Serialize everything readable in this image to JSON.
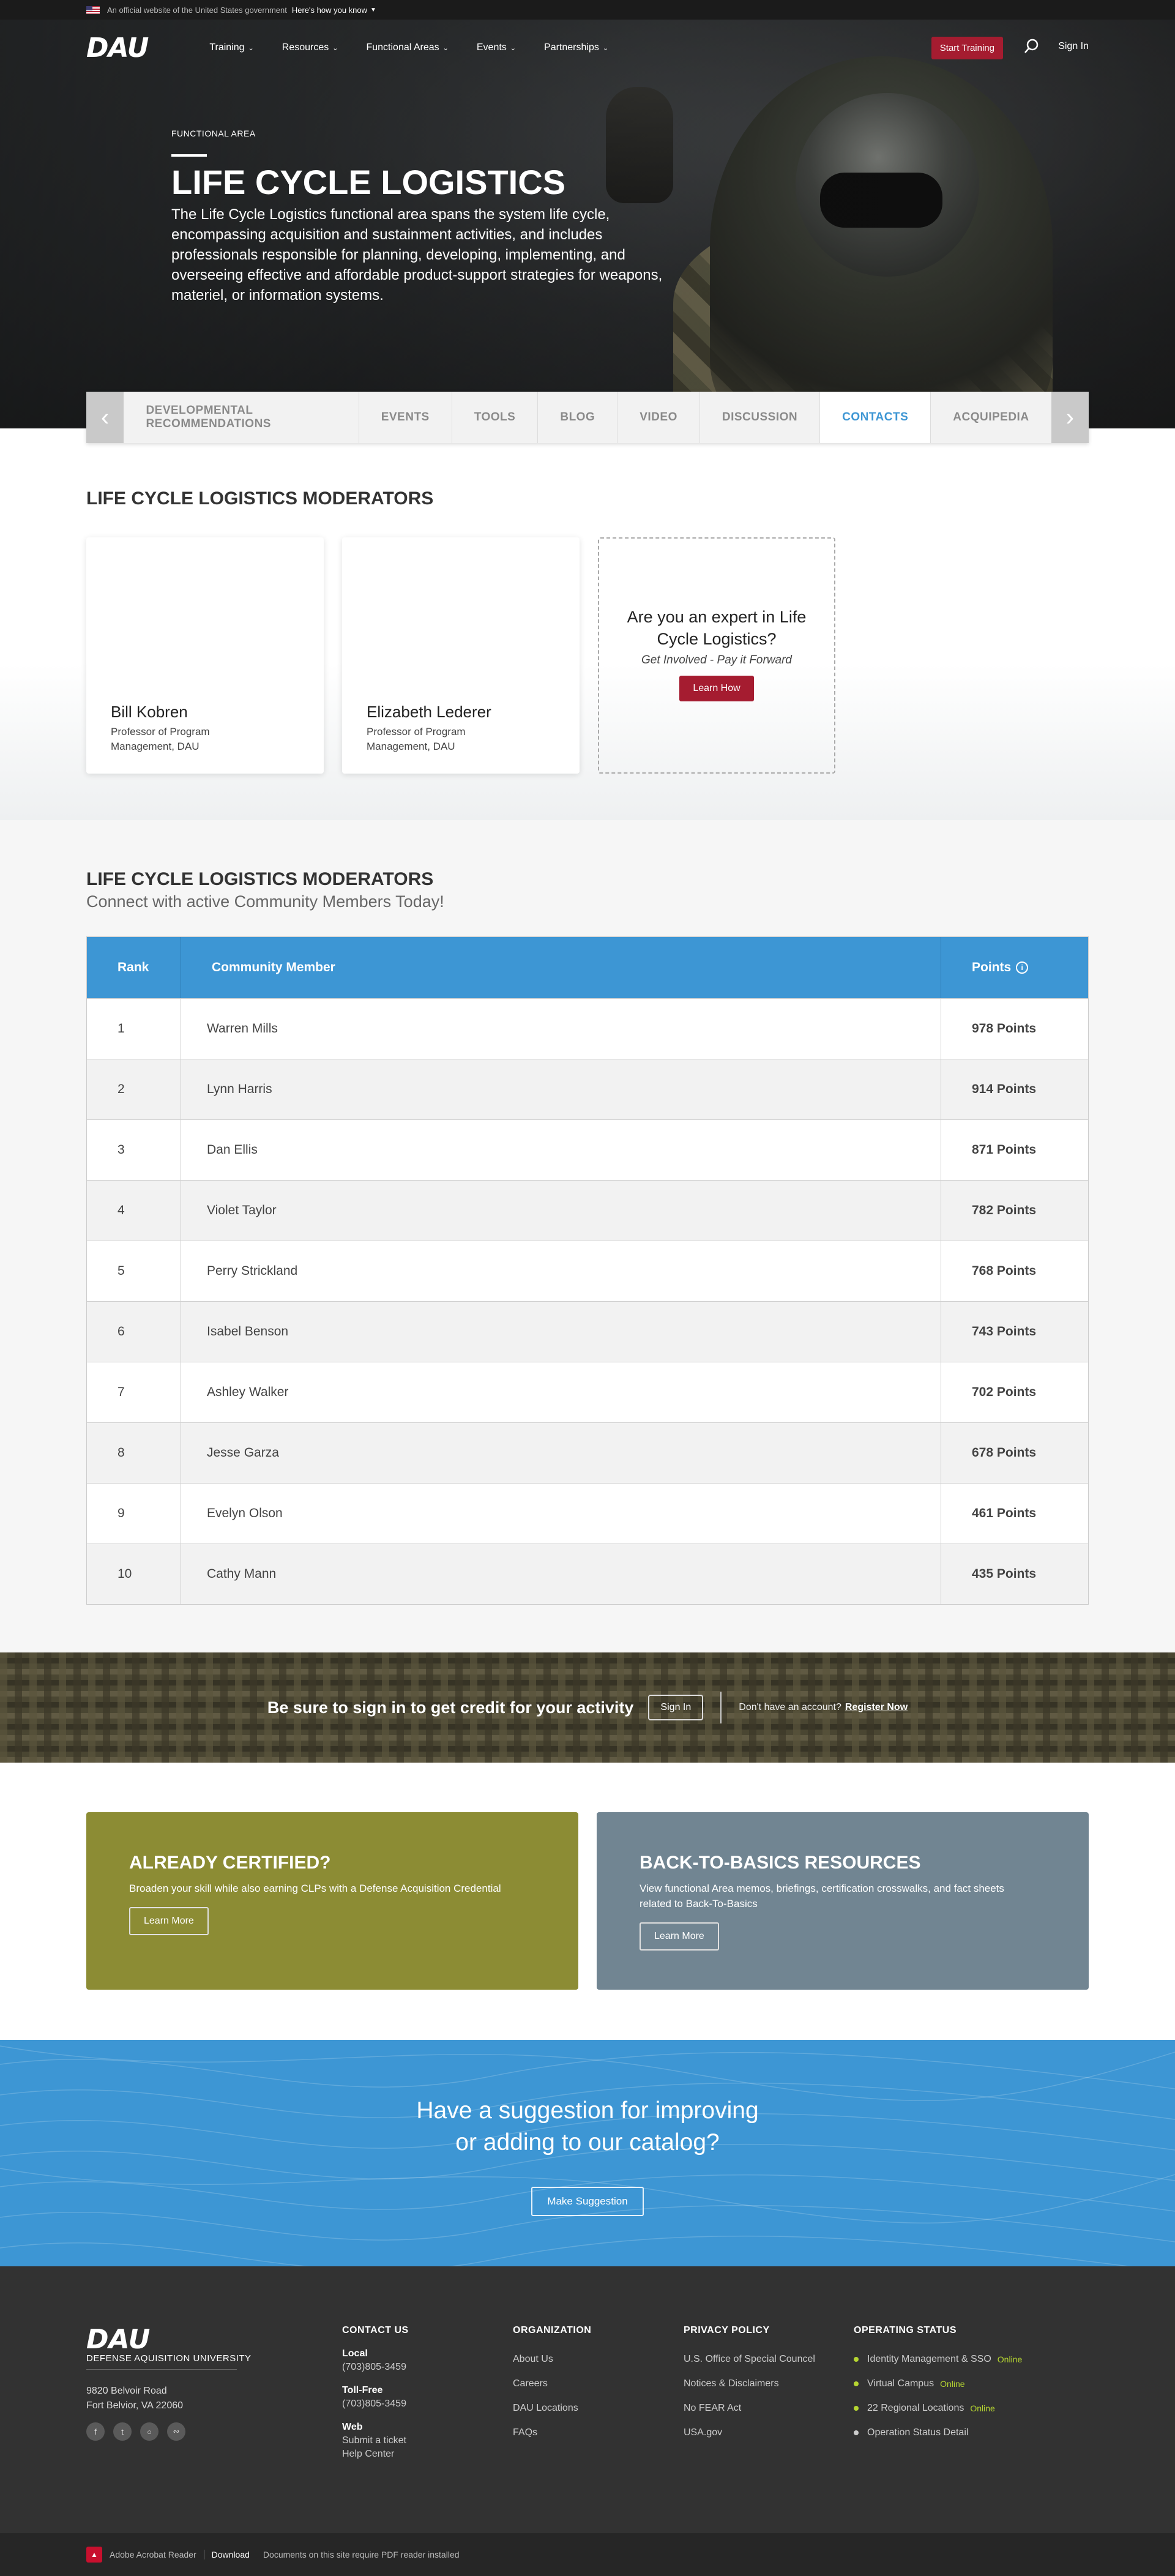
{
  "gov_banner": {
    "text": "An official website of the United States government",
    "link": "Here's how you know"
  },
  "header": {
    "logo": "DAU",
    "nav": [
      "Training",
      "Resources",
      "Functional Areas",
      "Events",
      "Partnerships"
    ],
    "start_training": "Start Training",
    "sign_in": "Sign In"
  },
  "hero": {
    "eyebrow": "FUNCTIONAL AREA",
    "title": "LIFE CYCLE LOGISTICS",
    "description": "The Life Cycle Logistics functional area spans the system life cycle, encompassing acquisition and sustainment activities, and includes professionals responsible for planning, developing, implementing, and overseeing effective and affordable product-support strategies for weapons, materiel, or information systems."
  },
  "tabs": {
    "items": [
      "DEVELOPMENTAL RECOMMENDATIONS",
      "EVENTS",
      "TOOLS",
      "BLOG",
      "VIDEO",
      "DISCUSSION",
      "CONTACTS",
      "ACQUIPEDIA"
    ],
    "active": "CONTACTS"
  },
  "moderators": {
    "title": "LIFE CYCLE LOGISTICS MODERATORS",
    "cards": [
      {
        "name": "Bill Kobren",
        "role": "Professor of Program Management, DAU"
      },
      {
        "name": "Elizabeth Lederer",
        "role": "Professor of Program Management, DAU"
      }
    ],
    "expert": {
      "question": "Are you an expert in Life Cycle Logistics?",
      "subtitle": "Get Involved - Pay it Forward",
      "button": "Learn How"
    }
  },
  "leaderboard": {
    "title": "LIFE CYCLE LOGISTICS MODERATORS",
    "subtitle": "Connect with active Community Members Today!",
    "headers": {
      "rank": "Rank",
      "member": "Community Member",
      "points": "Points"
    },
    "rows": [
      {
        "rank": "1",
        "member": "Warren Mills",
        "points": "978 Points"
      },
      {
        "rank": "2",
        "member": "Lynn Harris",
        "points": "914 Points"
      },
      {
        "rank": "3",
        "member": "Dan Ellis",
        "points": "871 Points"
      },
      {
        "rank": "4",
        "member": "Violet Taylor",
        "points": "782 Points"
      },
      {
        "rank": "5",
        "member": "Perry Strickland",
        "points": "768 Points"
      },
      {
        "rank": "6",
        "member": "Isabel Benson",
        "points": "743 Points"
      },
      {
        "rank": "7",
        "member": "Ashley Walker",
        "points": "702 Points"
      },
      {
        "rank": "8",
        "member": "Jesse Garza",
        "points": "678 Points"
      },
      {
        "rank": "9",
        "member": "Evelyn Olson",
        "points": "461 Points"
      },
      {
        "rank": "10",
        "member": "Cathy Mann",
        "points": "435 Points"
      }
    ]
  },
  "signin_band": {
    "message": "Be sure to sign in to get credit for your activity",
    "button": "Sign In",
    "no_account": "Don't have an account?",
    "register": "Register Now"
  },
  "promos": [
    {
      "title": "ALREADY CERTIFIED?",
      "text": "Broaden your skill while also earning CLPs with a Defense Acquisition Credential",
      "button": "Learn More",
      "color": "#8c8c34"
    },
    {
      "title": "BACK-TO-BASICS RESOURCES",
      "text": "View functional Area memos, briefings, certification crosswalks, and fact sheets related to Back-To-Basics",
      "button": "Learn More",
      "color": "#718592"
    }
  ],
  "suggestion": {
    "title_line1": "Have a suggestion for improving",
    "title_line2": "or adding to our catalog?",
    "button": "Make Suggestion"
  },
  "footer": {
    "logo": "DAU",
    "university": "DEFENSE AQUISITION UNIVERSITY",
    "address_line1": "9820 Belvoir Road",
    "address_line2": "Fort Belvior, VA 22060",
    "contact": {
      "title": "CONTACT US",
      "local_label": "Local",
      "local_phone": "(703)805-3459",
      "tollfree_label": "Toll-Free",
      "tollfree_phone": "(703)805-3459",
      "web_label": "Web",
      "web_link1": "Submit a ticket",
      "web_link2": "Help Center"
    },
    "organization": {
      "title": "ORGANIZATION",
      "links": [
        "About Us",
        "Careers",
        "DAU Locations",
        "FAQs"
      ]
    },
    "privacy": {
      "title": "PRIVACY POLICY",
      "links": [
        "U.S. Office of Special Councel",
        "Notices & Disclaimers",
        "No FEAR Act",
        "USA.gov"
      ]
    },
    "status": {
      "title": "OPERATING STATUS",
      "items": [
        {
          "label": "Identity Management & SSO",
          "state": "Online"
        },
        {
          "label": "Virtual Campus",
          "state": "Online"
        },
        {
          "label": "22 Regional Locations",
          "state": "Online"
        },
        {
          "label": "Operation Status Detail",
          "state": ""
        }
      ]
    }
  },
  "subfooter": {
    "reader": "Adobe Acrobat Reader",
    "download": "Download",
    "note": "Documents on this site require PDF reader installed"
  }
}
